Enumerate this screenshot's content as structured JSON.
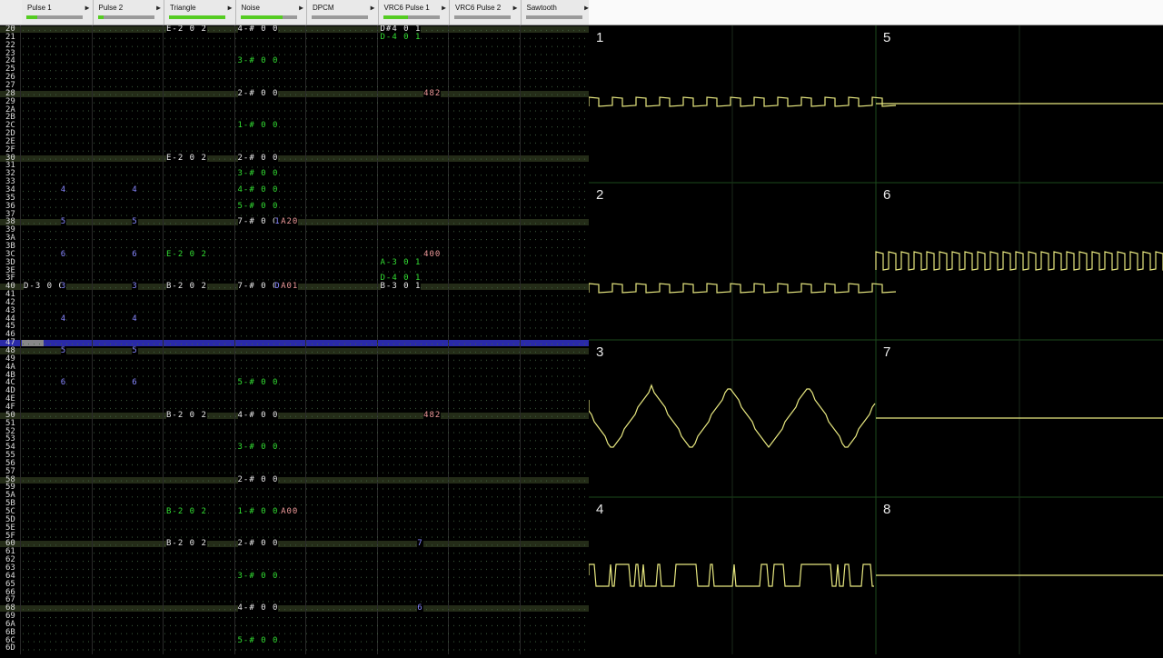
{
  "channels": [
    {
      "name": "Pulse 1",
      "meter": 0.2
    },
    {
      "name": "Pulse 2",
      "meter": 0.1
    },
    {
      "name": "Triangle",
      "meter": 1.0
    },
    {
      "name": "Noise",
      "meter": 0.75
    },
    {
      "name": "DPCM",
      "meter": 0
    },
    {
      "name": "VRC6 Pulse 1",
      "meter": 0.45
    },
    {
      "name": "VRC6 Pulse 2",
      "meter": 0
    },
    {
      "name": "Sawtooth",
      "meter": 0
    }
  ],
  "arrow_glyph": "▶",
  "rows": [
    "20",
    "21",
    "22",
    "23",
    "24",
    "25",
    "26",
    "27",
    "28",
    "29",
    "2A",
    "2B",
    "2C",
    "2D",
    "2E",
    "2F",
    "30",
    "31",
    "32",
    "33",
    "34",
    "35",
    "36",
    "37",
    "38",
    "39",
    "3A",
    "3B",
    "3C",
    "3D",
    "3E",
    "3F",
    "40",
    "41",
    "42",
    "43",
    "44",
    "45",
    "46",
    "47",
    "48",
    "49",
    "4A",
    "4B",
    "4C",
    "4D",
    "4E",
    "4F",
    "50",
    "51",
    "52",
    "53",
    "54",
    "55",
    "56",
    "57",
    "58",
    "59",
    "5A",
    "5B",
    "5C",
    "5D",
    "5E",
    "5F",
    "60",
    "61",
    "62",
    "63",
    "64",
    "65",
    "66",
    "67",
    "68",
    "69",
    "6A",
    "6B",
    "6C",
    "6D"
  ],
  "highlight_rows": [
    0,
    8,
    16,
    24,
    32,
    40,
    48,
    56,
    64,
    72
  ],
  "cursor_row": 39,
  "notes": [
    {
      "row": 0,
      "col": 2,
      "t": "E-2 0 2",
      "c": "#e8e8e8"
    },
    {
      "row": 0,
      "col": 3,
      "t": "4-# 0 0",
      "c": "#e8e8e8"
    },
    {
      "row": 0,
      "col": 5,
      "t": "D#4 0 1",
      "c": "#e8e8e8"
    },
    {
      "row": 1,
      "col": 5,
      "t": "D-4 0 1",
      "c": "#33dd33"
    },
    {
      "row": 4,
      "col": 3,
      "t": "3-# 0 0",
      "c": "#33dd33"
    },
    {
      "row": 8,
      "col": 3,
      "t": "2-# 0 0",
      "c": "#e8e8e8"
    },
    {
      "row": 8,
      "col": 5,
      "t": "482",
      "c": "#ee9999",
      "off": 7
    },
    {
      "row": 12,
      "col": 3,
      "t": "1-# 0 0",
      "c": "#33dd33"
    },
    {
      "row": 16,
      "col": 2,
      "t": "E-2 0 2",
      "c": "#e8e8e8"
    },
    {
      "row": 16,
      "col": 3,
      "t": "2-# 0 0",
      "c": "#e8e8e8"
    },
    {
      "row": 18,
      "col": 3,
      "t": "3-# 0 0",
      "c": "#33dd33"
    },
    {
      "row": 20,
      "col": 0,
      "t": "4",
      "c": "#8888ff",
      "off": 6
    },
    {
      "row": 20,
      "col": 1,
      "t": "4",
      "c": "#8888ff",
      "off": 6
    },
    {
      "row": 20,
      "col": 3,
      "t": "4-# 0 0",
      "c": "#33dd33"
    },
    {
      "row": 22,
      "col": 3,
      "t": "5-# 0 0",
      "c": "#33dd33"
    },
    {
      "row": 24,
      "col": 0,
      "t": "5",
      "c": "#8888ff",
      "off": 6
    },
    {
      "row": 24,
      "col": 1,
      "t": "5",
      "c": "#8888ff",
      "off": 6
    },
    {
      "row": 24,
      "col": 3,
      "t": "7-# 0 0",
      "c": "#e8e8e8"
    },
    {
      "row": 24,
      "col": 3,
      "t": "1",
      "c": "#8888ff",
      "off": 6
    },
    {
      "row": 24,
      "col": 3,
      "t": "A20",
      "c": "#ee9999",
      "off": 7
    },
    {
      "row": 28,
      "col": 0,
      "t": "6",
      "c": "#8888ff",
      "off": 6
    },
    {
      "row": 28,
      "col": 1,
      "t": "6",
      "c": "#8888ff",
      "off": 6
    },
    {
      "row": 28,
      "col": 2,
      "t": "E-2 0 2",
      "c": "#33dd33"
    },
    {
      "row": 28,
      "col": 5,
      "t": "400",
      "c": "#ee9999",
      "off": 7
    },
    {
      "row": 29,
      "col": 5,
      "t": "A-3 0 1",
      "c": "#33dd33"
    },
    {
      "row": 31,
      "col": 5,
      "t": "D-4 0 1",
      "c": "#33dd33"
    },
    {
      "row": 32,
      "col": 0,
      "t": "D-3 0 0",
      "c": "#e8e8e8"
    },
    {
      "row": 32,
      "col": 0,
      "t": "3",
      "c": "#8888ff",
      "off": 6
    },
    {
      "row": 32,
      "col": 1,
      "t": "3",
      "c": "#8888ff",
      "off": 6
    },
    {
      "row": 32,
      "col": 2,
      "t": "B-2 0 2",
      "c": "#e8e8e8"
    },
    {
      "row": 32,
      "col": 3,
      "t": "7-# 0 0",
      "c": "#e8e8e8"
    },
    {
      "row": 32,
      "col": 3,
      "t": "D",
      "c": "#8888ff",
      "off": 6
    },
    {
      "row": 32,
      "col": 3,
      "t": "A01",
      "c": "#ee9999",
      "off": 7
    },
    {
      "row": 32,
      "col": 5,
      "t": "B-3 0 1",
      "c": "#e8e8e8"
    },
    {
      "row": 36,
      "col": 0,
      "t": "4",
      "c": "#8888ff",
      "off": 6
    },
    {
      "row": 36,
      "col": 1,
      "t": "4",
      "c": "#8888ff",
      "off": 6
    },
    {
      "row": 40,
      "col": 0,
      "t": "5",
      "c": "#8888ff",
      "off": 6
    },
    {
      "row": 40,
      "col": 1,
      "t": "5",
      "c": "#8888ff",
      "off": 6
    },
    {
      "row": 44,
      "col": 0,
      "t": "6",
      "c": "#8888ff",
      "off": 6
    },
    {
      "row": 44,
      "col": 1,
      "t": "6",
      "c": "#8888ff",
      "off": 6
    },
    {
      "row": 44,
      "col": 3,
      "t": "5-# 0 0",
      "c": "#33dd33"
    },
    {
      "row": 48,
      "col": 2,
      "t": "B-2 0 2",
      "c": "#e8e8e8"
    },
    {
      "row": 48,
      "col": 3,
      "t": "4-# 0 0",
      "c": "#e8e8e8"
    },
    {
      "row": 48,
      "col": 5,
      "t": "482",
      "c": "#ee9999",
      "off": 7
    },
    {
      "row": 52,
      "col": 3,
      "t": "3-# 0 0",
      "c": "#33dd33"
    },
    {
      "row": 56,
      "col": 3,
      "t": "2-# 0 0",
      "c": "#e8e8e8"
    },
    {
      "row": 60,
      "col": 2,
      "t": "B-2 0 2",
      "c": "#33dd33"
    },
    {
      "row": 60,
      "col": 3,
      "t": "1-# 0 0",
      "c": "#33dd33"
    },
    {
      "row": 60,
      "col": 3,
      "t": "A00",
      "c": "#ee9999",
      "off": 7
    },
    {
      "row": 64,
      "col": 2,
      "t": "B-2 0 2",
      "c": "#e8e8e8"
    },
    {
      "row": 64,
      "col": 3,
      "t": "2-# 0 0",
      "c": "#e8e8e8"
    },
    {
      "row": 64,
      "col": 5,
      "t": "7",
      "c": "#8888ff",
      "off": 6
    },
    {
      "row": 68,
      "col": 3,
      "t": "3-# 0 0",
      "c": "#33dd33"
    },
    {
      "row": 72,
      "col": 3,
      "t": "4-# 0 0",
      "c": "#e8e8e8"
    },
    {
      "row": 72,
      "col": 5,
      "t": "6",
      "c": "#8888ff",
      "off": 6
    },
    {
      "row": 76,
      "col": 3,
      "t": "5-# 0 0",
      "c": "#33dd33"
    }
  ],
  "scopes": [
    {
      "label": "1",
      "wave": "pulse_slow"
    },
    {
      "label": "2",
      "wave": "pulse_slow_low"
    },
    {
      "label": "3",
      "wave": "triangle"
    },
    {
      "label": "4",
      "wave": "noise"
    },
    {
      "label": "5",
      "wave": "flat"
    },
    {
      "label": "6",
      "wave": "pulse_fast"
    },
    {
      "label": "7",
      "wave": "flat"
    },
    {
      "label": "8",
      "wave": "flat"
    }
  ],
  "colors": {
    "wave": "#e8e880",
    "grid": "#1c4a1c",
    "rownum": "#dddddd"
  }
}
